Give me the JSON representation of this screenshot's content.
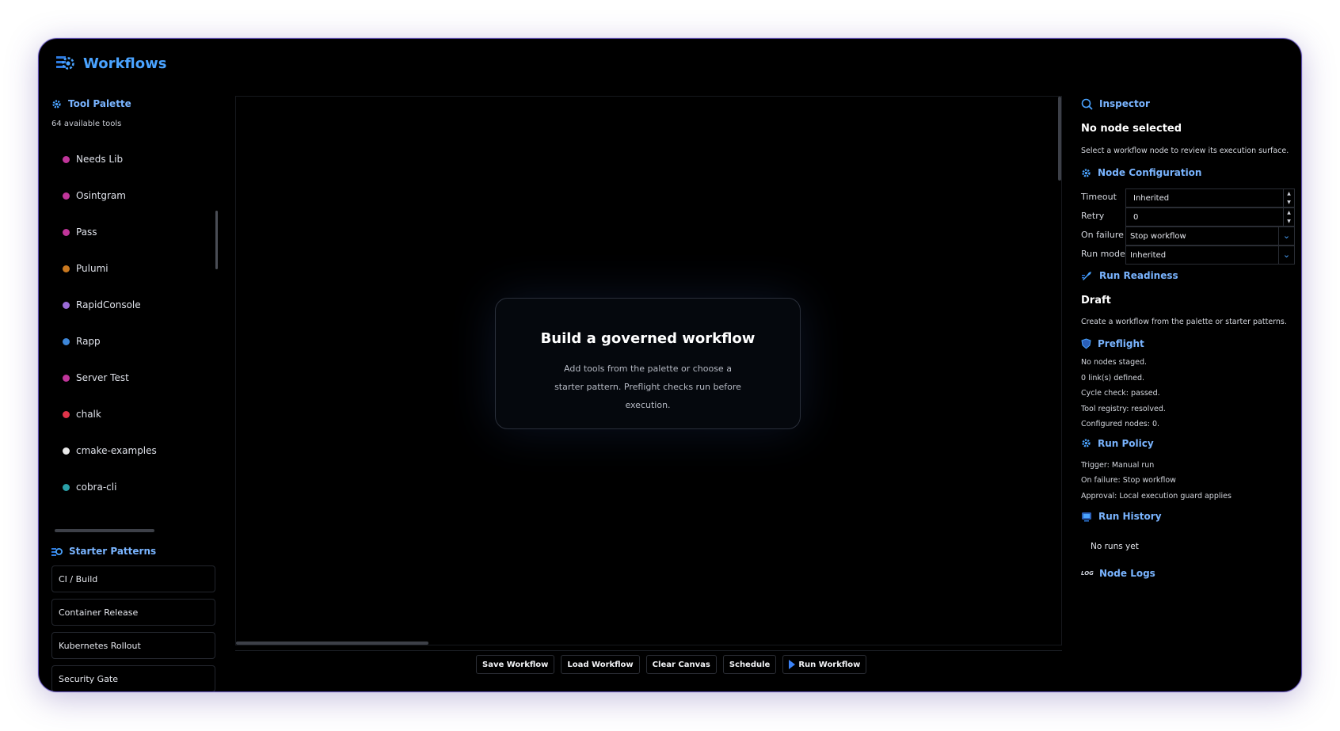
{
  "app": {
    "title": "Workflows"
  },
  "palette": {
    "title": "Tool Palette",
    "count_text": "64 available tools",
    "tools": [
      {
        "label": "Needs Lib",
        "color": "#c0359a"
      },
      {
        "label": "Osintgram",
        "color": "#c0359a"
      },
      {
        "label": "Pass",
        "color": "#c0359a"
      },
      {
        "label": "Pulumi",
        "color": "#c9781f"
      },
      {
        "label": "RapidConsole",
        "color": "#9b6bd6"
      },
      {
        "label": "Rapp",
        "color": "#3d86d8"
      },
      {
        "label": "Server Test",
        "color": "#c0359a"
      },
      {
        "label": "chalk",
        "color": "#e0344a"
      },
      {
        "label": "cmake-examples",
        "color": "#e8e8e8"
      },
      {
        "label": "cobra-cli",
        "color": "#2aa0a8"
      }
    ]
  },
  "patterns": {
    "title": "Starter Patterns",
    "items": [
      "CI / Build",
      "Container Release",
      "Kubernetes Rollout",
      "Security Gate"
    ]
  },
  "canvas": {
    "empty_title": "Build a governed workflow",
    "empty_desc": "Add tools from the palette or choose a starter pattern. Preflight checks run before execution."
  },
  "actions": {
    "save": "Save Workflow",
    "load": "Load Workflow",
    "clear": "Clear Canvas",
    "schedule": "Schedule",
    "run": "Run Workflow"
  },
  "inspector": {
    "title": "Inspector",
    "no_node": "No node selected",
    "no_node_desc": "Select a workflow node to review its execution surface.",
    "config_title": "Node Configuration",
    "timeout_label": "Timeout",
    "timeout_value": "Inherited",
    "retry_label": "Retry",
    "retry_value": "0",
    "onfail_label": "On failure",
    "onfail_value": "Stop workflow",
    "runmode_label": "Run mode",
    "runmode_value": "Inherited",
    "readiness_title": "Run Readiness",
    "readiness_status": "Draft",
    "readiness_desc": "Create a workflow from the palette or starter patterns.",
    "preflight_title": "Preflight",
    "preflight_items": [
      "No nodes staged.",
      "0 link(s) defined.",
      "Cycle check: passed.",
      "Tool registry: resolved.",
      "Configured nodes: 0."
    ],
    "policy_title": "Run Policy",
    "policy_items": [
      "Trigger: Manual run",
      "On failure: Stop workflow",
      "Approval: Local execution guard applies"
    ],
    "history_title": "Run History",
    "history_empty": "No runs yet",
    "logs_badge": "LOG",
    "logs_title": "Node Logs"
  },
  "colors": {
    "accent": "#4aa3ff",
    "heading": "#79b4ff",
    "background": "#000000"
  }
}
